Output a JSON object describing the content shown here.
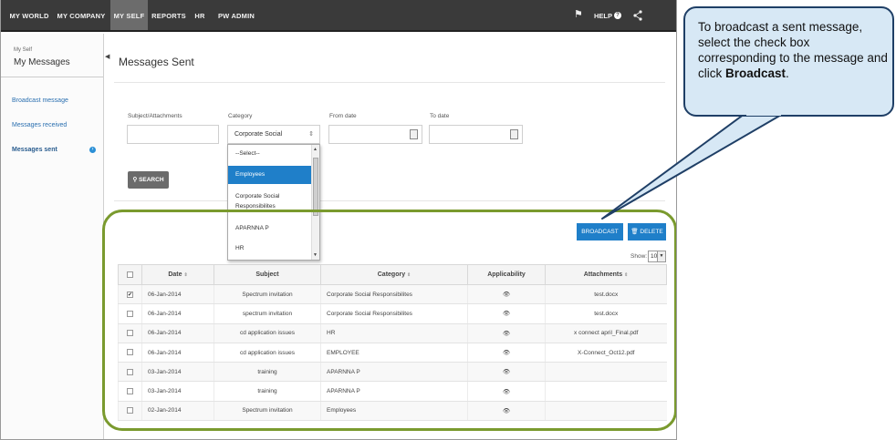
{
  "topnav": {
    "items": [
      "MY WORLD",
      "MY COMPANY",
      "MY SELF",
      "REPORTS",
      "HR",
      "PW ADMIN"
    ],
    "help": "HELP"
  },
  "sidebar": {
    "small_label": "My Self",
    "title": "My Messages",
    "links": [
      "Broadcast message",
      "Messages received",
      "Messages sent"
    ]
  },
  "main": {
    "title": "Messages Sent",
    "filters": {
      "subject_label": "Subject/Attachments",
      "category_label": "Category",
      "category_value": "Corporate Social",
      "from_label": "From date",
      "to_label": "To date"
    },
    "search_button": "SEARCH",
    "dropdown_options": [
      "--Select--",
      "Employees",
      "Corporate Social Responsibilites",
      "APARNNA P",
      "HR"
    ],
    "broadcast_button": "BROADCAST",
    "delete_button": "DELETE",
    "show_label": "Show:",
    "show_value": "10"
  },
  "table": {
    "headers": [
      "Date",
      "Subject",
      "Category",
      "Applicability",
      "Attachments"
    ],
    "rows": [
      {
        "checked": true,
        "date": "06-Jan-2014",
        "subject": "Spectrum invitation",
        "category": "Corporate Social Responsibilites",
        "attachment": "test.docx"
      },
      {
        "checked": false,
        "date": "06-Jan-2014",
        "subject": "spectrum invitation",
        "category": "Corporate Social Responsibilites",
        "attachment": "test.docx"
      },
      {
        "checked": false,
        "date": "06-Jan-2014",
        "subject": "cd application issues",
        "category": "HR",
        "attachment": "x connect april_Final.pdf"
      },
      {
        "checked": false,
        "date": "06-Jan-2014",
        "subject": "cd application issues",
        "category": "EMPLOYEE",
        "attachment": "X-Connect_Oct12.pdf"
      },
      {
        "checked": false,
        "date": "03-Jan-2014",
        "subject": "training",
        "category": "APARNNA P",
        "attachment": ""
      },
      {
        "checked": false,
        "date": "03-Jan-2014",
        "subject": "training",
        "category": "APARNNA P",
        "attachment": ""
      },
      {
        "checked": false,
        "date": "02-Jan-2014",
        "subject": "Spectrum invitation",
        "category": "Employees",
        "attachment": ""
      }
    ]
  },
  "callout": {
    "text_prefix": "To broadcast a sent message, select the check box corresponding to the message and click ",
    "text_bold": "Broadcast",
    "text_suffix": "."
  },
  "colors": {
    "accent_blue": "#1f7fc9",
    "highlight_green": "#7a9a2e",
    "callout_fill": "#d7e8f5",
    "callout_border": "#1f3f66",
    "nav_dark": "#3a3a3a"
  }
}
